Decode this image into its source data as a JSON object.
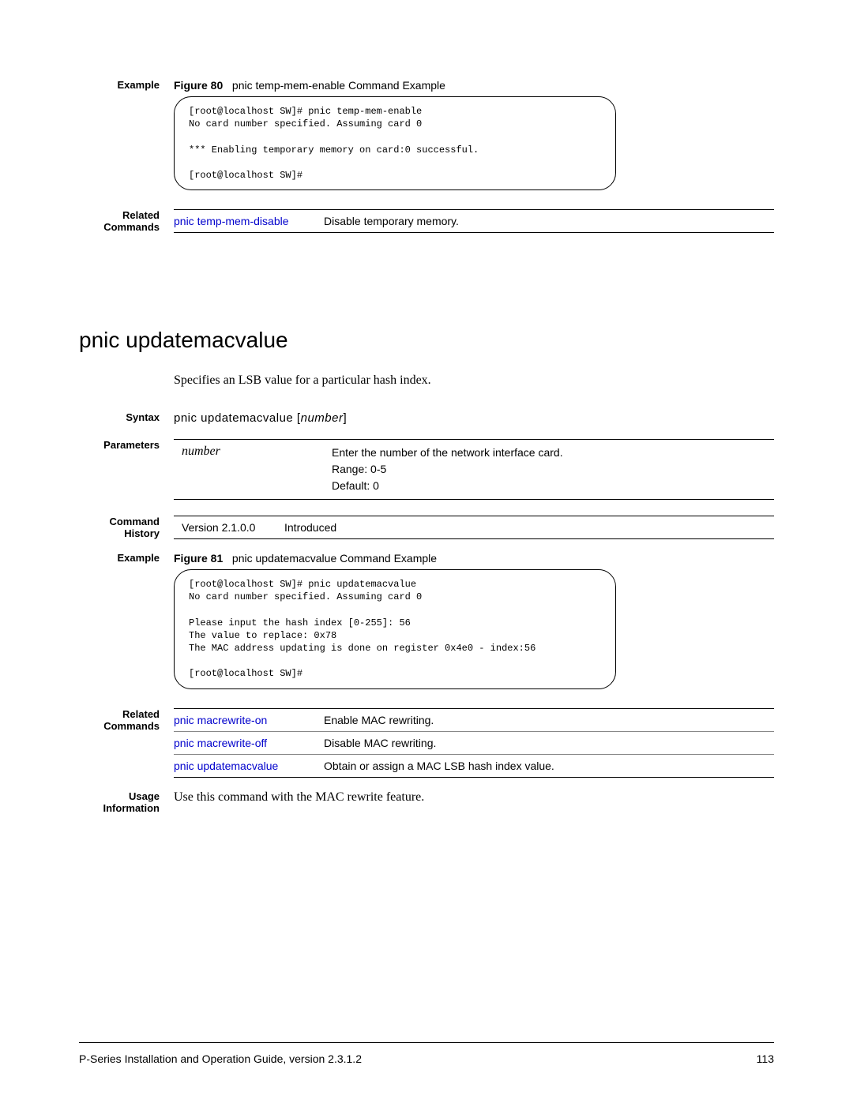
{
  "sec1": {
    "example_label": "Example",
    "fig_prefix": "Figure 80",
    "fig_caption": "pnic temp-mem-enable Command Example",
    "terminal": "[root@localhost SW]# pnic temp-mem-enable\nNo card number specified. Assuming card 0\n\n*** Enabling temporary memory on card:0 successful.\n\n[root@localhost SW]#",
    "related_label_l1": "Related",
    "related_label_l2": "Commands",
    "rel_cmd": "pnic temp-mem-disable",
    "rel_desc": "Disable temporary memory."
  },
  "sec2": {
    "title": "pnic updatemacvalue",
    "intro": "Specifies an LSB value for a particular hash index.",
    "syntax_label": "Syntax",
    "syntax_cmd": "pnic updatemacvalue",
    "syntax_arg": "number",
    "params_label": "Parameters",
    "param_name": "number",
    "param_desc_l1": "Enter the number of the network interface card.",
    "param_desc_l2": "Range: 0-5",
    "param_desc_l3": "Default: 0",
    "hist_label_l1": "Command",
    "hist_label_l2": "History",
    "hist_ver": "Version 2.1.0.0",
    "hist_note": "Introduced",
    "example_label": "Example",
    "fig_prefix": "Figure 81",
    "fig_caption": "pnic updatemacvalue Command Example",
    "terminal": "[root@localhost SW]# pnic updatemacvalue\nNo card number specified. Assuming card 0\n\nPlease input the hash index [0-255]: 56\nThe value to replace: 0x78\nThe MAC address updating is done on register 0x4e0 - index:56\n\n[root@localhost SW]#",
    "related_label_l1": "Related",
    "related_label_l2": "Commands",
    "rel": [
      {
        "cmd": "pnic macrewrite-on",
        "desc": "Enable MAC rewriting."
      },
      {
        "cmd": "pnic macrewrite-off",
        "desc": "Disable MAC rewriting."
      },
      {
        "cmd": "pnic updatemacvalue",
        "desc": "Obtain or assign a MAC LSB hash index value."
      }
    ],
    "usage_label_l1": "Usage",
    "usage_label_l2": "Information",
    "usage_text": "Use this command with the MAC rewrite feature."
  },
  "footer": {
    "left": "P-Series Installation and Operation Guide, version 2.3.1.2",
    "right": "113"
  }
}
